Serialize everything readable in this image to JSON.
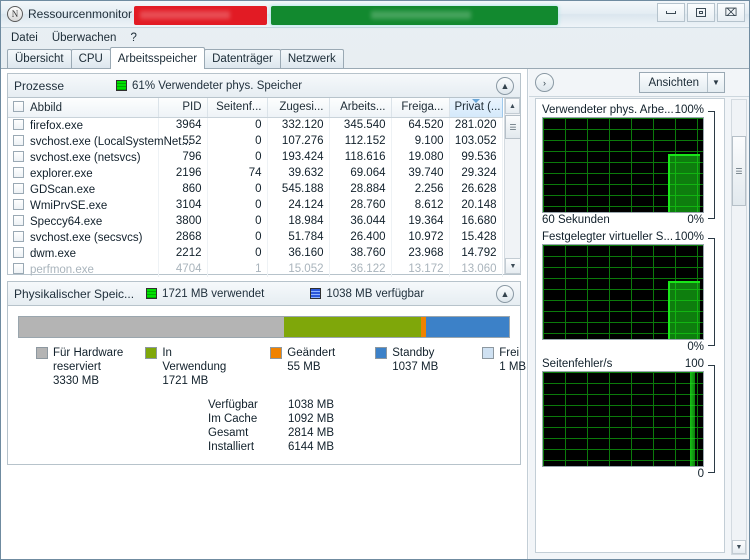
{
  "window": {
    "title": "Ressourcenmonitor",
    "icon": "resource-monitor-icon",
    "redacted_bar_red": "#e21b24",
    "redacted_bar_green": "#12892f",
    "controls": {
      "minimize": "–",
      "restore": "▣",
      "close": "⌧"
    }
  },
  "menu": {
    "items": [
      "Datei",
      "Überwachen",
      "?"
    ]
  },
  "tabs": {
    "items": [
      "Übersicht",
      "CPU",
      "Arbeitsspeicher",
      "Datenträger",
      "Netzwerk"
    ],
    "active": "Arbeitsspeicher"
  },
  "processes_panel": {
    "title": "Prozesse",
    "status": "61% Verwendeter phys. Speicher",
    "collapse_icon": "▲",
    "columns": [
      "Abbild",
      "PID",
      "Seitenf...",
      "Zugesi...",
      "Arbeits...",
      "Freiga...",
      "Privat (..."
    ],
    "sorted_column": "Privat (...",
    "rows": [
      {
        "name": "firefox.exe",
        "pid": "3964",
        "faults": "0",
        "commit": "332.120",
        "working": "345.540",
        "shareable": "64.520",
        "private": "281.020"
      },
      {
        "name": "svchost.exe (LocalSystemNet...",
        "pid": "552",
        "faults": "0",
        "commit": "107.276",
        "working": "112.152",
        "shareable": "9.100",
        "private": "103.052"
      },
      {
        "name": "svchost.exe (netsvcs)",
        "pid": "796",
        "faults": "0",
        "commit": "193.424",
        "working": "118.616",
        "shareable": "19.080",
        "private": "99.536"
      },
      {
        "name": "explorer.exe",
        "pid": "2196",
        "faults": "74",
        "commit": "39.632",
        "working": "69.064",
        "shareable": "39.740",
        "private": "29.324"
      },
      {
        "name": "GDScan.exe",
        "pid": "860",
        "faults": "0",
        "commit": "545.188",
        "working": "28.884",
        "shareable": "2.256",
        "private": "26.628"
      },
      {
        "name": "WmiPrvSE.exe",
        "pid": "3104",
        "faults": "0",
        "commit": "24.124",
        "working": "28.760",
        "shareable": "8.612",
        "private": "20.148"
      },
      {
        "name": "Speccy64.exe",
        "pid": "3800",
        "faults": "0",
        "commit": "18.984",
        "working": "36.044",
        "shareable": "19.364",
        "private": "16.680"
      },
      {
        "name": "svchost.exe (secsvcs)",
        "pid": "2868",
        "faults": "0",
        "commit": "51.784",
        "working": "26.400",
        "shareable": "10.972",
        "private": "15.428"
      },
      {
        "name": "dwm.exe",
        "pid": "2212",
        "faults": "0",
        "commit": "36.160",
        "working": "38.760",
        "shareable": "23.968",
        "private": "14.792"
      },
      {
        "name": "perfmon.exe",
        "pid": "4704",
        "faults": "1",
        "commit": "15.052",
        "working": "36.122",
        "shareable": "13.172",
        "private": "13.060"
      }
    ]
  },
  "memory_panel": {
    "title": "Physikalischer Speic...",
    "used_label": "1721 MB verwendet",
    "available_label": "1038 MB verfügbar",
    "collapse_icon": "▲",
    "segments": [
      {
        "key": "hardware",
        "label": "Für Hardware reserviert",
        "value": "3330 MB",
        "color": "#b4b4b4",
        "percent": 54.1
      },
      {
        "key": "inuse",
        "label": "In Verwendung",
        "value": "1721 MB",
        "color": "#7fa70a",
        "percent": 28.0
      },
      {
        "key": "modified",
        "label": "Geändert",
        "value": "55 MB",
        "color": "#ef8200",
        "percent": 0.9
      },
      {
        "key": "standby",
        "label": "Standby",
        "value": "1037 MB",
        "color": "#3c81c8",
        "percent": 17.0
      },
      {
        "key": "free",
        "label": "Frei",
        "value": "1 MB",
        "color": "#cfe1f2",
        "percent": 0.0
      }
    ],
    "legend": [
      {
        "label_line1": "Für Hardware",
        "label_line2": "reserviert",
        "value": "3330 MB",
        "color": "#b4b4b4"
      },
      {
        "label_line1": "In",
        "label_line2": "Verwendung",
        "value": "1721 MB",
        "color": "#7fa70a"
      },
      {
        "label_line1": "Geändert",
        "label_line2": "",
        "value": "55 MB",
        "color": "#ef8200"
      },
      {
        "label_line1": "Standby",
        "label_line2": "",
        "value": "1037 MB",
        "color": "#3c81c8"
      },
      {
        "label_line1": "Frei",
        "label_line2": "",
        "value": "1 MB",
        "color": "#cfe1f2"
      }
    ],
    "stats": [
      {
        "key": "Verfügbar",
        "value": "1038 MB"
      },
      {
        "key": "Im Cache",
        "value": "1092 MB"
      },
      {
        "key": "Gesamt",
        "value": "2814 MB"
      },
      {
        "key": "Installiert",
        "value": "6144 MB"
      }
    ]
  },
  "right_panel": {
    "expand_icon": "›",
    "views_label": "Ansichten",
    "views_caret": "▼",
    "graphs": [
      {
        "title": "Verwendeter phys. Arbe...",
        "max": "100%",
        "footer_left": "60 Sekunden",
        "footer_right": "0%",
        "series_color": "#19e619",
        "fill_percent": 62
      },
      {
        "title": "Festgelegter virtueller S...",
        "max": "100%",
        "footer_left": "",
        "footer_right": "0%",
        "series_color": "#19e619",
        "fill_percent": 62
      },
      {
        "title": "Seitenfehler/s",
        "max": "100",
        "footer_left": "",
        "footer_right": "0",
        "series_color": "#19e619",
        "fill_percent": 95
      }
    ]
  },
  "chart_data": [
    {
      "type": "area",
      "title": "Verwendeter phys. Arbe...",
      "ylabel": "",
      "xlabel": "60 Sekunden",
      "ylim": [
        0,
        100
      ],
      "ytick_labels": [
        "100%",
        "0%"
      ],
      "grid": true,
      "series": [
        {
          "name": "Verwendeter phys. Arbeitsspeicher",
          "color": "#19e619",
          "values": [
            0,
            0,
            0,
            0,
            0,
            0,
            0,
            0,
            0,
            0,
            0,
            0,
            0,
            0,
            0,
            0,
            0,
            0,
            0,
            0,
            0,
            0,
            0,
            0,
            0,
            0,
            0,
            0,
            0,
            0,
            0,
            0,
            0,
            0,
            0,
            0,
            0,
            0,
            0,
            0,
            0,
            0,
            0,
            0,
            0,
            0,
            0,
            0,
            0,
            0,
            0,
            0,
            0,
            0,
            61,
            61,
            61,
            61,
            61,
            61
          ]
        }
      ]
    },
    {
      "type": "area",
      "title": "Festgelegter virtueller S...",
      "ylabel": "",
      "xlabel": "",
      "ylim": [
        0,
        100
      ],
      "ytick_labels": [
        "100%",
        "0%"
      ],
      "grid": true,
      "series": [
        {
          "name": "Festgelegter virtueller Speicher",
          "color": "#19e619",
          "values": [
            0,
            0,
            0,
            0,
            0,
            0,
            0,
            0,
            0,
            0,
            0,
            0,
            0,
            0,
            0,
            0,
            0,
            0,
            0,
            0,
            0,
            0,
            0,
            0,
            0,
            0,
            0,
            0,
            0,
            0,
            0,
            0,
            0,
            0,
            0,
            0,
            0,
            0,
            0,
            0,
            0,
            0,
            0,
            0,
            0,
            0,
            0,
            0,
            0,
            0,
            0,
            0,
            0,
            0,
            60,
            60,
            60,
            60,
            60,
            60
          ]
        }
      ]
    },
    {
      "type": "line",
      "title": "Seitenfehler/s",
      "ylabel": "",
      "xlabel": "",
      "ylim": [
        0,
        100
      ],
      "ytick_labels": [
        "100",
        "0"
      ],
      "grid": true,
      "series": [
        {
          "name": "Seitenfehler/s",
          "color": "#19e619",
          "values": [
            0,
            0,
            0,
            0,
            0,
            0,
            0,
            0,
            0,
            0,
            0,
            0,
            0,
            0,
            0,
            0,
            0,
            0,
            0,
            0,
            0,
            0,
            0,
            0,
            0,
            0,
            0,
            0,
            0,
            0,
            0,
            0,
            0,
            0,
            0,
            0,
            0,
            0,
            0,
            0,
            0,
            0,
            0,
            0,
            0,
            0,
            0,
            0,
            0,
            0,
            0,
            0,
            0,
            0,
            0,
            0,
            0,
            2,
            100,
            3
          ]
        }
      ]
    }
  ]
}
